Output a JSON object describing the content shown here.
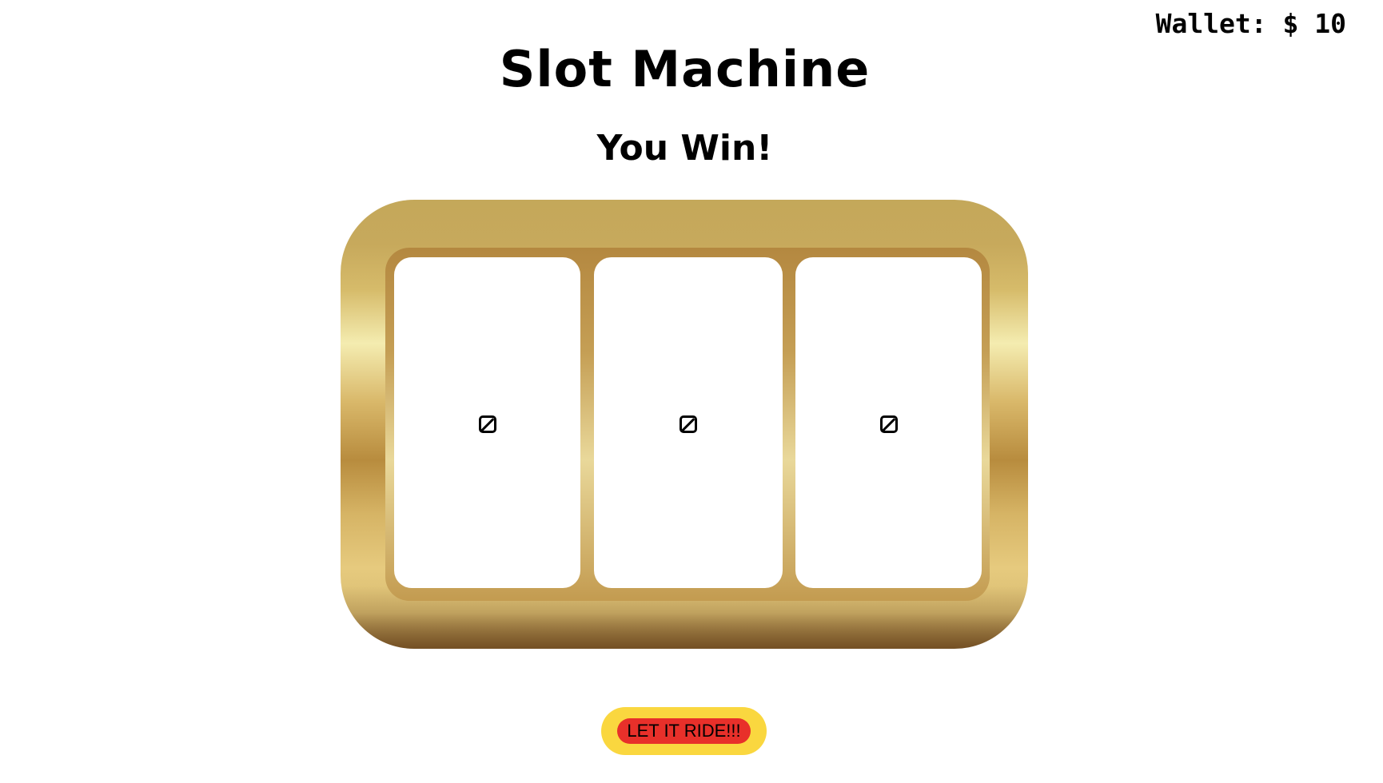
{
  "wallet": {
    "label": "Wallet: $ 10"
  },
  "header": {
    "title": "Slot Machine"
  },
  "game": {
    "status": "You Win!",
    "reels": [
      {
        "symbol": "broken-image-icon"
      },
      {
        "symbol": "broken-image-icon"
      },
      {
        "symbol": "broken-image-icon"
      }
    ]
  },
  "controls": {
    "spin_label": "LET IT RIDE!!!"
  },
  "colors": {
    "frame_gold": "#c4a85a",
    "button_yellow": "#fad73f",
    "button_red": "#e8302a"
  }
}
